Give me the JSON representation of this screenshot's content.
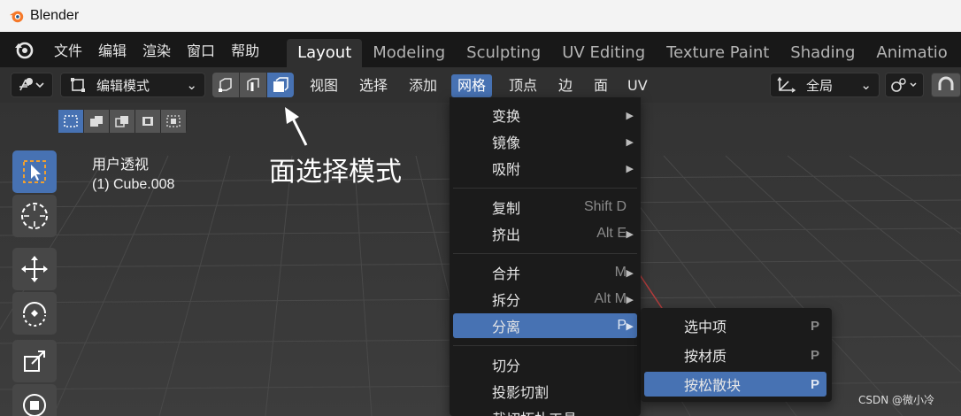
{
  "window": {
    "title": "Blender"
  },
  "topbar": {
    "menu": [
      "文件",
      "编辑",
      "渲染",
      "窗口",
      "帮助"
    ],
    "workspaces": [
      "Layout",
      "Modeling",
      "Sculpting",
      "UV Editing",
      "Texture Paint",
      "Shading",
      "Animatio"
    ],
    "active_workspace": "Layout"
  },
  "header": {
    "mode_label": "编辑模式",
    "menus": [
      "视图",
      "选择",
      "添加",
      "网格",
      "顶点",
      "边",
      "面",
      "UV"
    ],
    "active_menu": "网格",
    "transform_orientation": "全局"
  },
  "viewport": {
    "view_name": "用户透视",
    "object_name": "(1) Cube.008",
    "annotation": "面选择模式"
  },
  "mesh_menu": {
    "groups": [
      [
        {
          "label": "变换",
          "shortcut": "",
          "submenu": true
        },
        {
          "label": "镜像",
          "shortcut": "",
          "submenu": true
        },
        {
          "label": "吸附",
          "shortcut": "",
          "submenu": true
        }
      ],
      [
        {
          "label": "复制",
          "shortcut": "Shift D",
          "submenu": false
        },
        {
          "label": "挤出",
          "shortcut": "Alt E",
          "submenu": true
        }
      ],
      [
        {
          "label": "合并",
          "shortcut": "M",
          "submenu": true
        },
        {
          "label": "拆分",
          "shortcut": "Alt M",
          "submenu": true
        },
        {
          "label": "分离",
          "shortcut": "P",
          "submenu": true
        }
      ],
      [
        {
          "label": "切分",
          "shortcut": "",
          "submenu": false
        },
        {
          "label": "投影切割",
          "shortcut": "",
          "submenu": false
        },
        {
          "label": "裁切拓扑工具",
          "shortcut": "",
          "submenu": false
        }
      ]
    ],
    "highlighted": "分离"
  },
  "separate_submenu": {
    "items": [
      {
        "label": "选中项",
        "shortcut": "P"
      },
      {
        "label": "按材质",
        "shortcut": "P"
      },
      {
        "label": "按松散块",
        "shortcut": "P"
      }
    ],
    "highlighted": "按松散块"
  },
  "watermark": "CSDN @微小冷",
  "colors": {
    "accent": "#4772b3",
    "menu_bg": "#1b1b1b",
    "viewport_bg": "#3a3a3a"
  }
}
